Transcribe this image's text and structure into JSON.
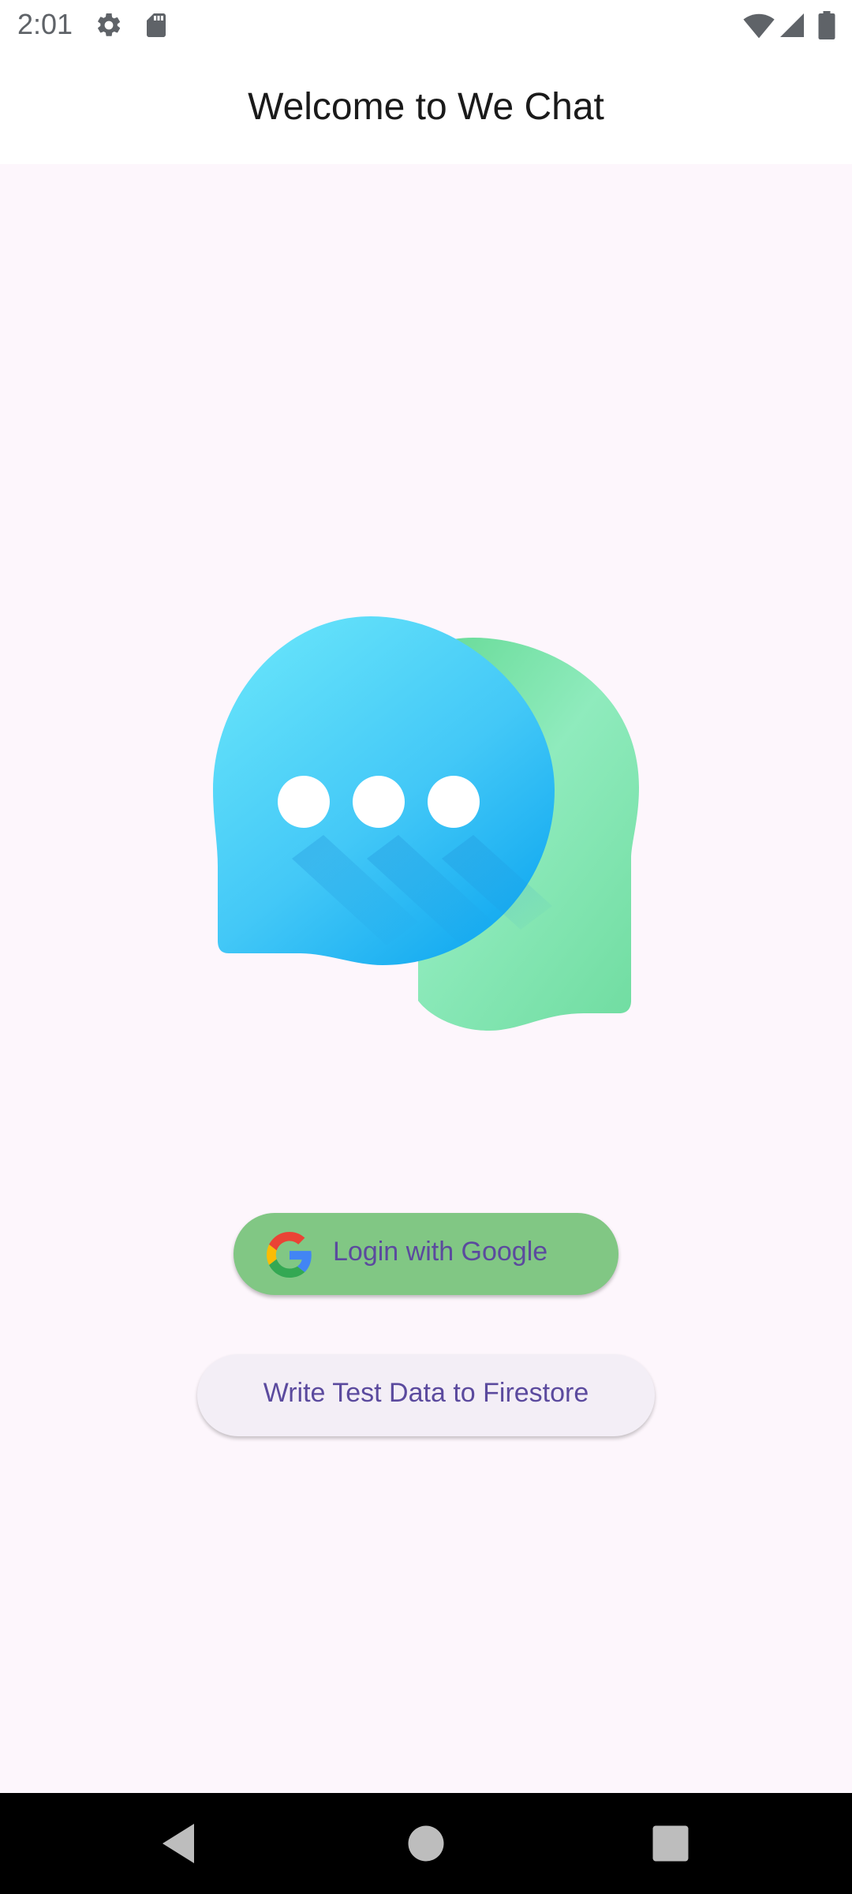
{
  "status_bar": {
    "time": "2:01",
    "icons": [
      "gear-icon",
      "sd-card-icon",
      "wifi-icon",
      "cellular-signal-icon",
      "battery-icon"
    ]
  },
  "app_bar": {
    "title": "Welcome to We Chat"
  },
  "main": {
    "logo": "chat-bubbles-logo",
    "login_button_label": "Login with Google",
    "login_button_icon": "google-g-icon",
    "firestore_button_label": "Write Test Data to Firestore"
  },
  "nav_bar": {
    "buttons": [
      "back-icon",
      "home-icon",
      "recents-icon"
    ]
  },
  "colors": {
    "background": "#fdf6fc",
    "app_bar": "#ffffff",
    "login_button": "#81c784",
    "button_text": "#5b4a9e",
    "secondary_button": "#f3eef6",
    "bubble_blue": "#29b6f6",
    "bubble_green": "#6fe0a0"
  }
}
